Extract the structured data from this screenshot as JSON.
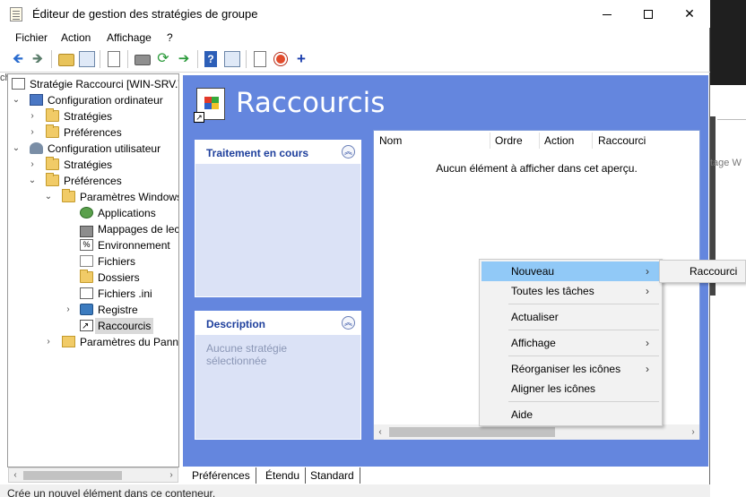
{
  "window": {
    "title": "Éditeur de gestion des stratégies de groupe",
    "controls": {
      "minimize": "—",
      "maximize": "□",
      "close": "✕"
    }
  },
  "menu": [
    "Fichier",
    "Action",
    "Affichage",
    "?"
  ],
  "toolbar": {
    "icons": [
      "back-arrow-icon",
      "forward-arrow-icon",
      "up-folder-icon",
      "show-hide-tree-icon",
      "properties-icon",
      "print-icon",
      "refresh-icon",
      "export-list-icon",
      "help-icon",
      "details-icon",
      "new-window-icon",
      "stop-icon",
      "add-icon"
    ],
    "back": "🡸",
    "forward": "🡺",
    "refresh": "⟳",
    "export": "➔",
    "help": "?",
    "add": "+"
  },
  "tree": {
    "root": "Stratégie Raccourci [WIN-SRV.T",
    "nodes": [
      {
        "label": "Configuration ordinateur",
        "expander": "⌄"
      },
      {
        "label": "Stratégies",
        "expander": "›"
      },
      {
        "label": "Préférences",
        "expander": "›"
      },
      {
        "label": "Configuration utilisateur",
        "expander": "⌄"
      },
      {
        "label": "Stratégies",
        "expander": "›"
      },
      {
        "label": "Préférences",
        "expander": "⌄"
      },
      {
        "label": "Paramètres Windows",
        "expander": "⌄"
      },
      {
        "label": "Applications",
        "expander": ""
      },
      {
        "label": "Mappages de lect",
        "expander": ""
      },
      {
        "label": "Environnement",
        "expander": ""
      },
      {
        "label": "Fichiers",
        "expander": ""
      },
      {
        "label": "Dossiers",
        "expander": ""
      },
      {
        "label": "Fichiers .ini",
        "expander": ""
      },
      {
        "label": "Registre",
        "expander": "›"
      },
      {
        "label": "Raccourcis",
        "expander": ""
      },
      {
        "label": "Paramètres du Panne",
        "expander": "›"
      }
    ],
    "env_glyph": "%",
    "scroll_left": "‹",
    "scroll_right": "›"
  },
  "right_pane": {
    "title": "Raccourcis",
    "panels": {
      "processing": {
        "title": "Traitement en cours",
        "collapse": "︽"
      },
      "description": {
        "title": "Description",
        "collapse": "︽",
        "body": "Aucune stratégie sélectionnée"
      }
    },
    "list": {
      "columns": [
        "Nom",
        "Ordre",
        "Action",
        "Raccourci"
      ],
      "empty": "Aucun élément à afficher dans cet aperçu.",
      "scroll_left": "‹",
      "scroll_right": "›"
    }
  },
  "tabs": [
    "Préférences",
    "Étendu",
    "Standard"
  ],
  "status": "Crée un nouvel élément dans ce conteneur.",
  "context_menu": {
    "items": [
      {
        "label": "Nouveau",
        "submenu": "›"
      },
      {
        "label": "Toutes les tâches",
        "submenu": "›"
      },
      {
        "label": "Actualiser",
        "submenu": ""
      },
      {
        "label": "Affichage",
        "submenu": "›"
      },
      {
        "label": "Réorganiser les icônes",
        "submenu": "›"
      },
      {
        "label": "Aligner les icônes",
        "submenu": ""
      },
      {
        "label": "Aide",
        "submenu": ""
      }
    ],
    "submenu": [
      "Raccourci"
    ]
  },
  "background": {
    "left_fragment": "ch",
    "right_fragment": "tage W"
  },
  "colors": {
    "pane_blue": "#6486de",
    "menu_highlight": "#91c9f7",
    "panel_title": "#1e3f9c"
  }
}
